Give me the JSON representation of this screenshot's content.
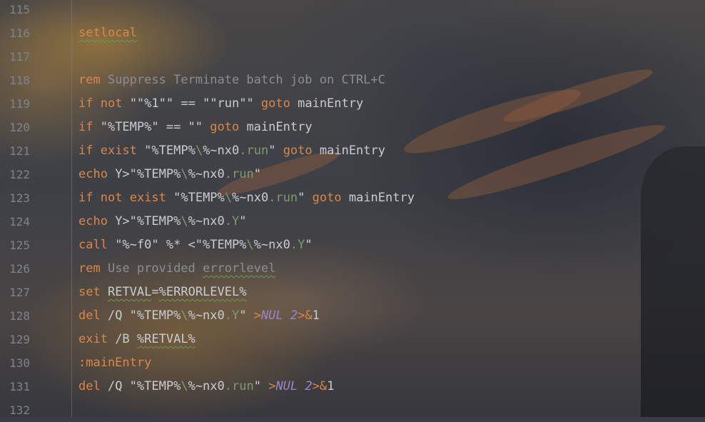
{
  "editor": {
    "language": "batch",
    "colors": {
      "keyword": "#d9874a",
      "comment": "#8a8e95",
      "text": "#c9ccd1",
      "extension": "#7d9b6f",
      "italic_constant": "#9b86c9",
      "line_number": "#7f838b"
    },
    "lines": [
      {
        "n": "115",
        "t": {}
      },
      {
        "n": "116",
        "t": {
          "a": "setlocal"
        }
      },
      {
        "n": "117",
        "t": {}
      },
      {
        "n": "118",
        "t": {
          "a": "rem",
          "b": " Suppress Terminate batch job on CTRL+C"
        }
      },
      {
        "n": "119",
        "t": {
          "a": "if",
          "b": " ",
          "c": "not",
          "d": " \"\"%1\"\" == \"\"run\"\" ",
          "e": "goto",
          "f": " mainEntry"
        }
      },
      {
        "n": "120",
        "t": {
          "a": "if",
          "b": " \"%TEMP%\" == \"\" ",
          "c": "goto",
          "d": " mainEntry"
        }
      },
      {
        "n": "121",
        "t": {
          "a": "if",
          "b": " ",
          "c": "exist",
          "d": " \"%TEMP%",
          "e": "\\",
          "f": "%~nx0",
          "g": ".run",
          "h": "\" ",
          "i": "goto",
          "j": " mainEntry"
        }
      },
      {
        "n": "122",
        "t": {
          "a": "echo",
          "b": " Y>\"%TEMP%",
          "c": "\\",
          "d": "%~nx0",
          "e": ".run",
          "f": "\""
        }
      },
      {
        "n": "123",
        "t": {
          "a": "if",
          "b": " ",
          "c": "not",
          "d": " ",
          "e": "exist",
          "f": " \"%TEMP%",
          "g": "\\",
          "h": "%~nx0",
          "i": ".run",
          "j": "\" ",
          "k": "goto",
          "l": " mainEntry"
        }
      },
      {
        "n": "124",
        "t": {
          "a": "echo",
          "b": " Y>\"%TEMP%",
          "c": "\\",
          "d": "%~nx0",
          "e": ".Y",
          "f": "\""
        }
      },
      {
        "n": "125",
        "t": {
          "a": "call",
          "b": " \"%~f0\" %* <\"%TEMP%",
          "c": "\\",
          "d": "%~nx0",
          "e": ".Y",
          "f": "\""
        }
      },
      {
        "n": "126",
        "t": {
          "a": "rem",
          "b": " Use provided ",
          "c": "errorlevel"
        }
      },
      {
        "n": "127",
        "t": {
          "a": "set",
          "b": " ",
          "c": "RETVAL",
          "d": "=",
          "e": "%ERRORLEVEL%"
        }
      },
      {
        "n": "128",
        "t": {
          "a": "del",
          "b": " /Q \"%TEMP%",
          "c": "\\",
          "d": "%~nx0",
          "e": ".Y",
          "f": "\" ",
          "g": ">",
          "h": "NUL",
          "i": " ",
          "j": "2",
          "k": ">&",
          "l": "1"
        }
      },
      {
        "n": "129",
        "t": {
          "a": "exit",
          "b": " /B ",
          "c": "%RETVAL%"
        }
      },
      {
        "n": "130",
        "t": {
          "a": ":mainEntry"
        }
      },
      {
        "n": "131",
        "t": {
          "a": "del",
          "b": " /Q \"%TEMP%",
          "c": "\\",
          "d": "%~nx0",
          "e": ".run",
          "f": "\" ",
          "g": ">",
          "h": "NUL",
          "i": " ",
          "j": "2",
          "k": ">&",
          "l": "1"
        }
      },
      {
        "n": "132",
        "t": {}
      }
    ]
  }
}
